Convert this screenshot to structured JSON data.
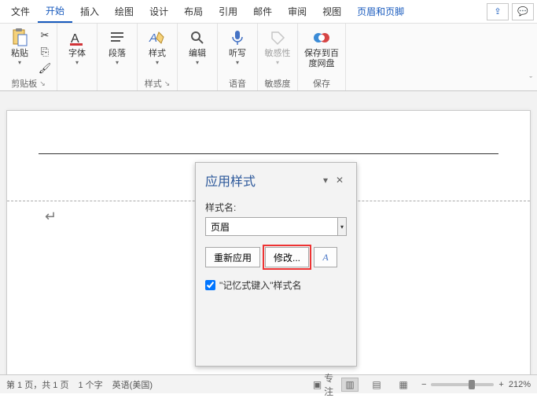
{
  "menu": {
    "file": "文件",
    "home": "开始",
    "insert": "插入",
    "draw": "绘图",
    "design": "设计",
    "layout": "布局",
    "references": "引用",
    "mail": "邮件",
    "review": "审阅",
    "view": "视图",
    "header_footer": "页眉和页脚"
  },
  "ribbon": {
    "clipboard": {
      "paste": "粘贴",
      "label": "剪贴板"
    },
    "font": {
      "btn": "字体"
    },
    "para": {
      "btn": "段落"
    },
    "styles": {
      "btn": "样式",
      "label": "样式"
    },
    "editing": {
      "btn": "编辑"
    },
    "dictate": {
      "btn": "听写",
      "label": "语音"
    },
    "sensitivity": {
      "btn": "敏感性",
      "label": "敏感度"
    },
    "save": {
      "btn": "保存到百度网盘",
      "label": "保存"
    }
  },
  "pane": {
    "title": "应用样式",
    "style_name_label": "样式名:",
    "style_value": "页眉",
    "reapply": "重新应用",
    "modify": "修改...",
    "remember": "\"记忆式键入\"样式名"
  },
  "status": {
    "page": "第 1 页，共 1 页",
    "words": "1 个字",
    "lang": "英语(美国)",
    "focus": "专注",
    "zoom": "212%"
  }
}
